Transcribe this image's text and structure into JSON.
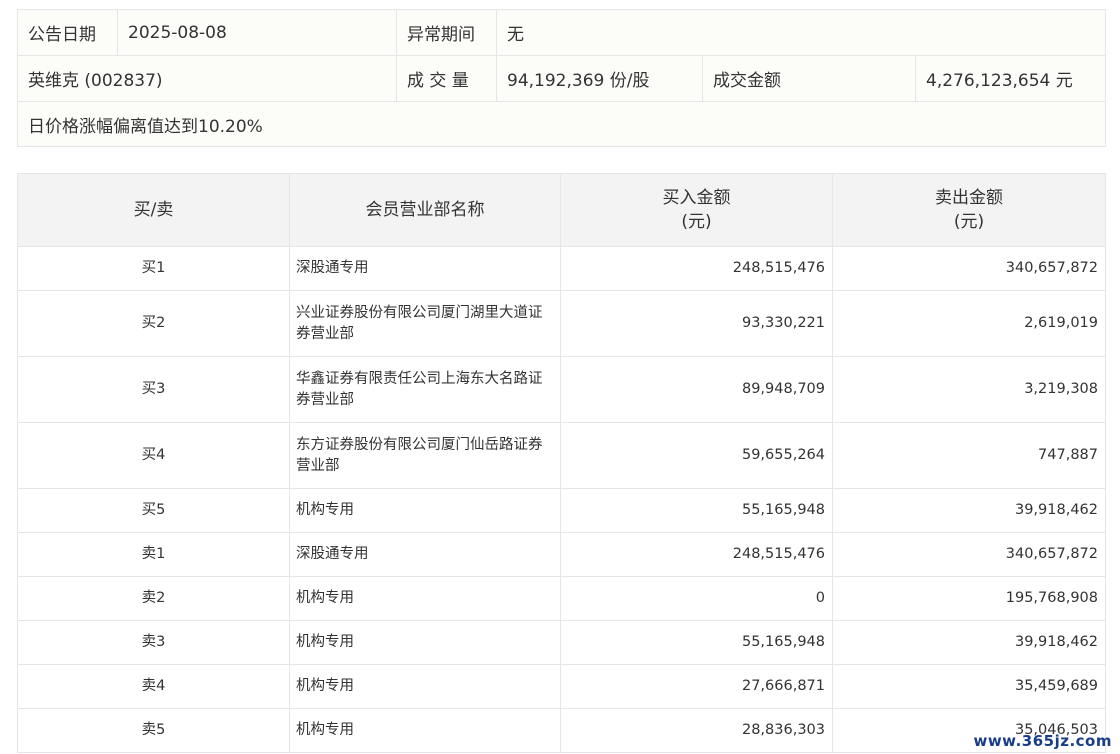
{
  "info": {
    "announce_date_label": "公告日期",
    "announce_date_value": "2025-08-08",
    "abnormal_period_label": "异常期间",
    "abnormal_period_value": "无",
    "stock": "英维克 (002837)",
    "volume_label": "成 交 量",
    "volume_value": "94,192,369 份/股",
    "amount_label": "成交金额",
    "amount_value": "4,276,123,654 元",
    "note": "日价格涨幅偏离值达到10.20%"
  },
  "table": {
    "headers": {
      "side": "买/卖",
      "member": "会员营业部名称",
      "buy_line1": "买入金额",
      "buy_line2": "(元)",
      "sell_line1": "卖出金额",
      "sell_line2": "(元)"
    },
    "rows": [
      {
        "side": "买1",
        "member": "深股通专用",
        "buy": "248,515,476",
        "sell": "340,657,872"
      },
      {
        "side": "买2",
        "member": "兴业证券股份有限公司厦门湖里大道证券营业部",
        "buy": "93,330,221",
        "sell": "2,619,019"
      },
      {
        "side": "买3",
        "member": "华鑫证券有限责任公司上海东大名路证券营业部",
        "buy": "89,948,709",
        "sell": "3,219,308"
      },
      {
        "side": "买4",
        "member": "东方证券股份有限公司厦门仙岳路证券营业部",
        "buy": "59,655,264",
        "sell": "747,887"
      },
      {
        "side": "买5",
        "member": "机构专用",
        "buy": "55,165,948",
        "sell": "39,918,462"
      },
      {
        "side": "卖1",
        "member": "深股通专用",
        "buy": "248,515,476",
        "sell": "340,657,872"
      },
      {
        "side": "卖2",
        "member": "机构专用",
        "buy": "0",
        "sell": "195,768,908"
      },
      {
        "side": "卖3",
        "member": "机构专用",
        "buy": "55,165,948",
        "sell": "39,918,462"
      },
      {
        "side": "卖4",
        "member": "机构专用",
        "buy": "27,666,871",
        "sell": "35,459,689"
      },
      {
        "side": "卖5",
        "member": "机构专用",
        "buy": "28,836,303",
        "sell": "35,046,503"
      }
    ]
  },
  "watermark": "www.365jz.com"
}
